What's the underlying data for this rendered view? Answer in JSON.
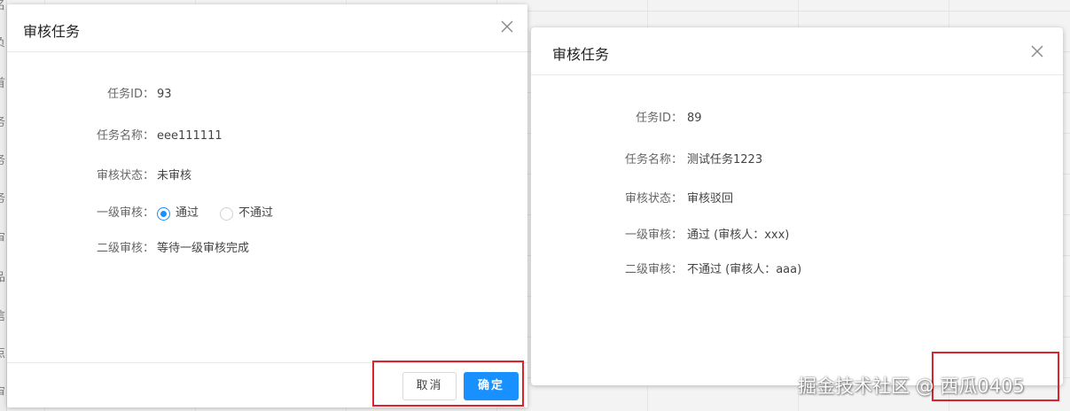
{
  "background": {
    "left_glyphs": [
      "名",
      "负",
      "首",
      "务",
      "务",
      "务",
      "审",
      "品",
      "信",
      "点",
      "审"
    ]
  },
  "dialog_left": {
    "title": "审核任务",
    "rows": [
      {
        "label": "任务ID：",
        "value": "93"
      },
      {
        "label": "任务名称：",
        "value": "eee111111"
      },
      {
        "label": "审核状态：",
        "value": "未审核"
      }
    ],
    "level1": {
      "label": "一级审核：",
      "options": [
        {
          "label": "通过",
          "checked": true
        },
        {
          "label": "不通过",
          "checked": false
        }
      ]
    },
    "level2": {
      "label": "二级审核：",
      "value": "等待一级审核完成"
    },
    "cancel_label": "取消",
    "ok_label": "确定"
  },
  "dialog_right": {
    "title": "审核任务",
    "rows": [
      {
        "label": "任务ID：",
        "value": "89"
      },
      {
        "label": "任务名称：",
        "value": "测试任务1223"
      },
      {
        "label": "审核状态：",
        "value": "审核驳回"
      },
      {
        "label": "一级审核：",
        "value": "通过 (审核人：xxx)"
      },
      {
        "label": "二级审核：",
        "value": "不通过 (审核人：aaa)"
      }
    ]
  },
  "watermark": "掘金技术社区 @ 西瓜0405",
  "colors": {
    "accent": "#1890ff",
    "highlight": "#d9232d"
  }
}
